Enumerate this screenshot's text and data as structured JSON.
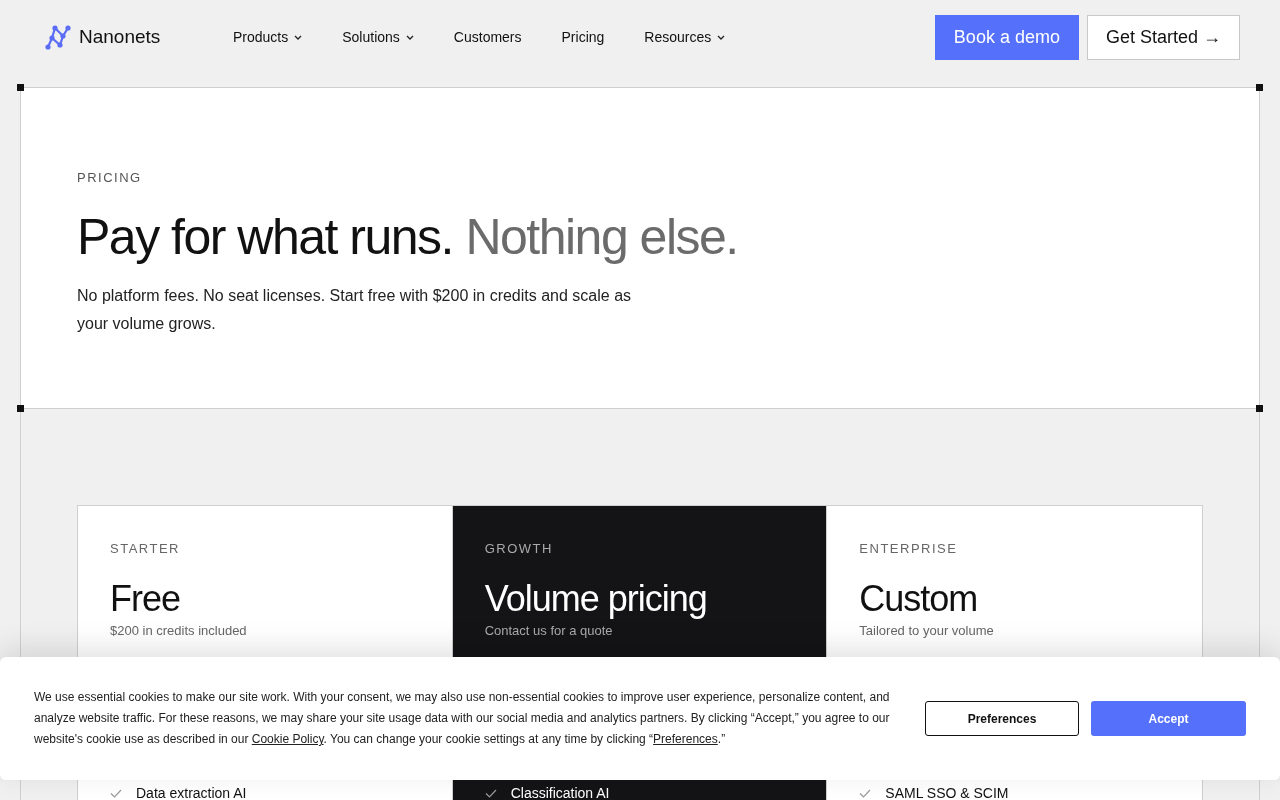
{
  "header": {
    "logo": "Nanonets",
    "nav": [
      {
        "label": "Products",
        "dropdown": true
      },
      {
        "label": "Solutions",
        "dropdown": true
      },
      {
        "label": "Customers",
        "dropdown": false
      },
      {
        "label": "Pricing",
        "dropdown": false
      },
      {
        "label": "Resources",
        "dropdown": true
      }
    ],
    "demo_button": "Book a demo",
    "start_button": "Get Started →"
  },
  "hero": {
    "eyebrow": "PRICING",
    "headline": "Pay for what runs.",
    "headline_muted": "Nothing else.",
    "description": "No platform fees. No seat licenses. Start free with $200 in credits and scale as your volume grows."
  },
  "plans": [
    {
      "tier": "STARTER",
      "price": "Free",
      "note": "$200 in credits included",
      "highlighted": false,
      "features": [
        "Data extraction AI"
      ]
    },
    {
      "tier": "GROWTH",
      "price": "Volume pricing",
      "note": "Contact us for a quote",
      "highlighted": true,
      "features": [
        "Classification AI"
      ]
    },
    {
      "tier": "ENTERPRISE",
      "price": "Custom",
      "note": "Tailored to your volume",
      "highlighted": false,
      "features": [
        "SAML SSO & SCIM"
      ]
    }
  ],
  "cookie_banner": {
    "text_before": "We use essential cookies to make our site work. With your consent, we may also use non-essential cookies to improve user experience, personalize content, and analyze website traffic. For these reasons, we may share your site usage data with our social media and analytics partners. By clicking “Accept,” you agree to our website's cookie use as described in our",
    "policy_link": "Cookie Policy",
    "text_middle": ". You can change your cookie settings at any time by clicking “",
    "preferences_link": "Preferences",
    "text_after": ".”",
    "preferences_button": "Preferences",
    "accept_button": "Accept"
  }
}
